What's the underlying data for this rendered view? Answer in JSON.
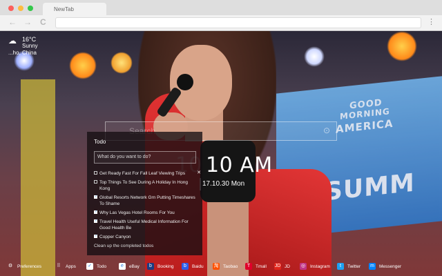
{
  "browser": {
    "tab_title": "NewTab",
    "window_buttons": [
      {
        "name": "close",
        "color": "#fc605c"
      },
      {
        "name": "minimize",
        "color": "#fdbc40"
      },
      {
        "name": "maximize",
        "color": "#34c84a"
      }
    ],
    "back_icon": "←",
    "forward_icon": "→",
    "reload_icon": "C",
    "menu_icon": "⋮",
    "url_value": ""
  },
  "weather": {
    "temperature": "16°C",
    "condition": "Sunny",
    "location": "...ho, China",
    "icon": "partly-sunny-icon"
  },
  "search": {
    "placeholder": "Search"
  },
  "clock": {
    "ghost_digits": "10",
    "time": "10 AM",
    "date": "17.10.30 Mon"
  },
  "todo": {
    "title": "Todo",
    "input_placeholder": "What do you want to do?",
    "items": [
      {
        "text": "Get Ready Fast For Fall Leaf Viewing Trips",
        "done": false
      },
      {
        "text": "Top Things To See During A Holiday In Hong Kong",
        "done": false
      },
      {
        "text": "Global Resorts Network Grn Putting Timeshares To Shame",
        "done": true
      },
      {
        "text": "Why Las Vegas Hotel Rooms For You",
        "done": true
      },
      {
        "text": "Travel Health Useful Medical Information For Good Health Be",
        "done": true
      },
      {
        "text": "Copper Canyon",
        "done": true
      }
    ],
    "delete_icon": "✕",
    "clear_label": "Clean up the completed todos"
  },
  "bottom_bar": {
    "items": [
      {
        "label": "Preferences",
        "icon": "gear-icon",
        "glyph": "⚙",
        "color": "transparent"
      },
      {
        "label": "Apps",
        "icon": "grid-icon",
        "glyph": "⠿",
        "color": "transparent"
      },
      {
        "label": "Todo",
        "icon": "checkbox-icon",
        "glyph": "✓",
        "color": "#ffffff"
      },
      {
        "label": "eBay",
        "icon": "ebay-icon",
        "glyph": "e",
        "color": "#ffffff"
      },
      {
        "label": "Booking",
        "icon": "booking-icon",
        "glyph": "b",
        "color": "#1b3c82"
      },
      {
        "label": "Baidu",
        "icon": "baidu-icon",
        "glyph": "b",
        "color": "#2d5ee8"
      },
      {
        "label": "Taobao",
        "icon": "taobao-icon",
        "glyph": "淘",
        "color": "#ff5000"
      },
      {
        "label": "Tmall",
        "icon": "tmall-icon",
        "glyph": "T",
        "color": "#e0002a"
      },
      {
        "label": "JD",
        "icon": "jd-icon",
        "glyph": "JD",
        "color": "#e1251b"
      },
      {
        "label": "Instagram",
        "icon": "instagram-icon",
        "glyph": "◎",
        "color": "#c13584"
      },
      {
        "label": "Twitter",
        "icon": "twitter-icon",
        "glyph": "t",
        "color": "#1da1f2"
      },
      {
        "label": "Messenger",
        "icon": "messenger-icon",
        "glyph": "m",
        "color": "#0084ff"
      }
    ]
  },
  "background": {
    "sign_lines": [
      "GOOD",
      "MORNING",
      "AMERICA",
      "SUMM"
    ]
  }
}
